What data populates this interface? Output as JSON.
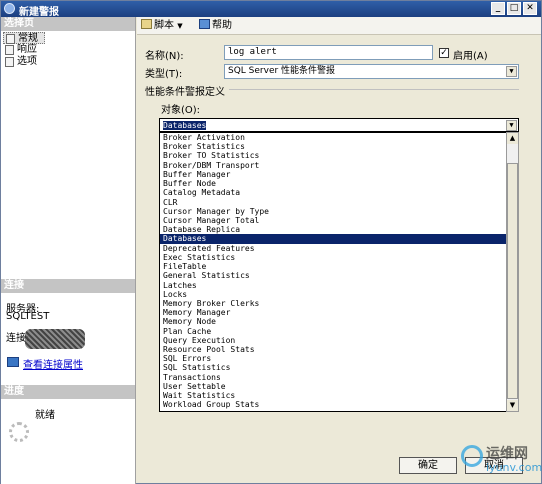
{
  "window": {
    "title": "新建警报"
  },
  "left": {
    "select_page_header": "选择页",
    "pages": [
      {
        "label": "常规"
      },
      {
        "label": "响应"
      },
      {
        "label": "选项"
      }
    ],
    "connection_header": "连接",
    "server_label": "服务器:",
    "server_value": "SQLTEST",
    "connection_label": "连接:",
    "view_link": "查看连接属性",
    "progress_header": "进度",
    "progress_status": "就绪"
  },
  "toolbar": {
    "script_label": "脚本",
    "help_label": "帮助"
  },
  "form": {
    "name_label": "名称(N):",
    "name_value": "log alert",
    "enable_label": "启用(A)",
    "enabled": true,
    "type_label": "类型(T):",
    "type_value": "SQL Server 性能条件警报",
    "section_label": "性能条件警报定义",
    "object_label": "对象(O):",
    "object_value": "Databases"
  },
  "object_options": [
    "Broker Activation",
    "Broker Statistics",
    "Broker TO Statistics",
    "Broker/DBM Transport",
    "Buffer Manager",
    "Buffer Node",
    "Catalog Metadata",
    "CLR",
    "Cursor Manager by Type",
    "Cursor Manager Total",
    "Database Replica",
    "Databases",
    "Deprecated Features",
    "Exec Statistics",
    "FileTable",
    "General Statistics",
    "Latches",
    "Locks",
    "Memory Broker Clerks",
    "Memory Manager",
    "Memory Node",
    "Plan Cache",
    "Query Execution",
    "Resource Pool Stats",
    "SQL Errors",
    "SQL Statistics",
    "Transactions",
    "User Settable",
    "Wait Statistics",
    "Workload Group Stats"
  ],
  "selected_option": "Databases",
  "buttons": {
    "ok_label": "确定",
    "cancel_label": "取消"
  },
  "watermark": {
    "text": "运维网",
    "url": "iyunv.com"
  }
}
